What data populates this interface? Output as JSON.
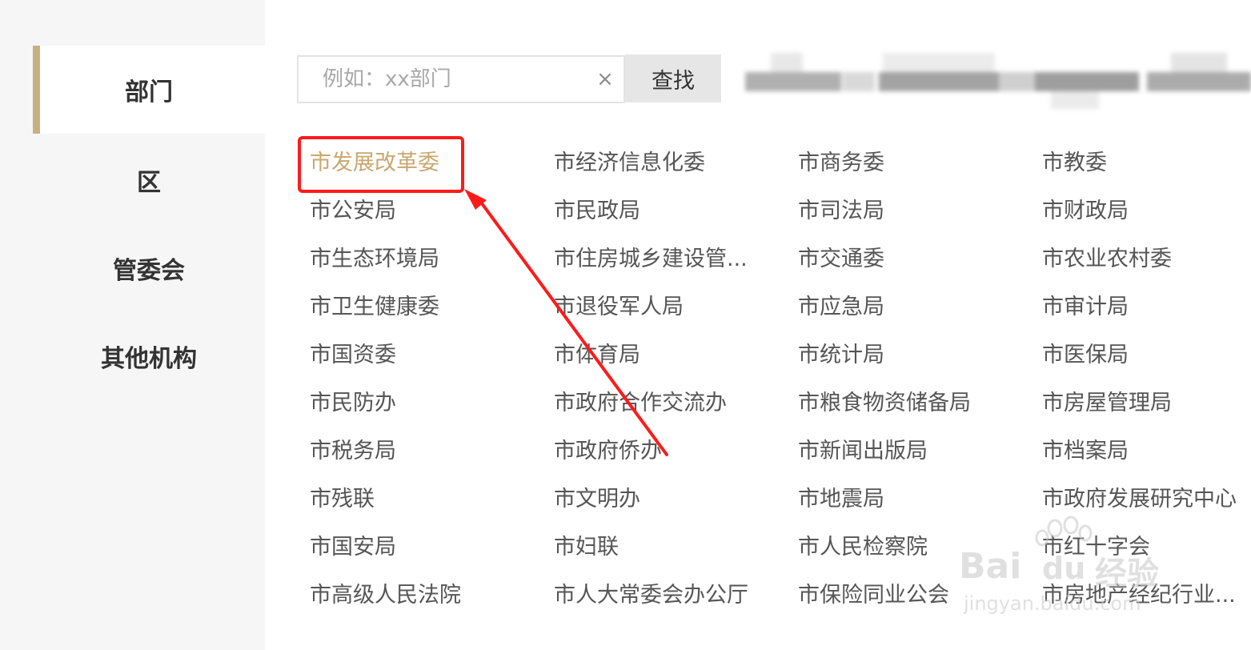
{
  "sidebar": {
    "items": [
      {
        "label": "部门",
        "active": true
      },
      {
        "label": "区",
        "active": false
      },
      {
        "label": "管委会",
        "active": false
      },
      {
        "label": "其他机构",
        "active": false
      }
    ]
  },
  "search": {
    "placeholder": "例如：xx部门",
    "clear_icon": "×",
    "button_label": "查找"
  },
  "departments": {
    "rows": [
      [
        "市发展改革委",
        "市经济信息化委",
        "市商务委",
        "市教委"
      ],
      [
        "市公安局",
        "市民政局",
        "市司法局",
        "市财政局"
      ],
      [
        "市生态环境局",
        "市住房城乡建设管...",
        "市交通委",
        "市农业农村委"
      ],
      [
        "市卫生健康委",
        "市退役军人局",
        "市应急局",
        "市审计局"
      ],
      [
        "市国资委",
        "市体育局",
        "市统计局",
        "市医保局"
      ],
      [
        "市民防办",
        "市政府合作交流办",
        "市粮食物资储备局",
        "市房屋管理局"
      ],
      [
        "市税务局",
        "市政府侨办",
        "市新闻出版局",
        "市档案局"
      ],
      [
        "市残联",
        "市文明办",
        "市地震局",
        "市政府发展研究中心"
      ],
      [
        "市国安局",
        "市妇联",
        "市人民检察院",
        "市红十字会"
      ],
      [
        "市高级人民法院",
        "市人大常委会办公厅",
        "市保险同业公会",
        "市房地产经纪行业..."
      ]
    ],
    "highlighted": "市发展改革委"
  },
  "colors": {
    "accent": "#c9b084",
    "highlight_text": "#c9a770",
    "annotation_red": "#ff1a1a",
    "sidebar_bg": "#f6f6f6"
  },
  "watermark": {
    "brand": "Bai",
    "brand_mid": "du",
    "brand_cn": "经验",
    "url": "jingyan.baidu.com"
  }
}
